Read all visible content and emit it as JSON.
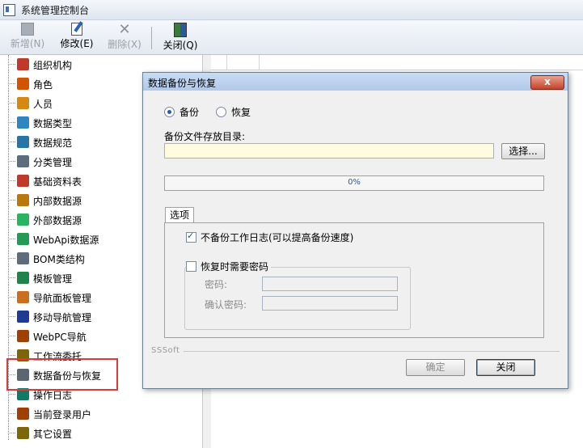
{
  "window": {
    "title": "系统管理控制台"
  },
  "toolbar": {
    "buttons": [
      {
        "label": "新增(N)",
        "icon": "new-icon",
        "enabled": false
      },
      {
        "label": "修改(E)",
        "icon": "edit-icon",
        "enabled": true
      },
      {
        "label": "删除(X)",
        "icon": "delete-icon",
        "enabled": false
      },
      {
        "label": "关闭(Q)",
        "icon": "close-door-icon",
        "enabled": true
      }
    ]
  },
  "tree": {
    "items": [
      {
        "label": "组织机构",
        "icon": "organization-icon",
        "color": "#c0392b"
      },
      {
        "label": "角色",
        "icon": "role-icon",
        "color": "#d35400"
      },
      {
        "label": "人员",
        "icon": "person-icon",
        "color": "#d68910"
      },
      {
        "label": "数据类型",
        "icon": "data-type-icon",
        "color": "#2e86c1"
      },
      {
        "label": "数据规范",
        "icon": "data-spec-icon",
        "color": "#2874a6"
      },
      {
        "label": "分类管理",
        "icon": "category-icon",
        "color": "#5d6d7e"
      },
      {
        "label": "基础资料表",
        "icon": "base-table-icon",
        "color": "#c0392b"
      },
      {
        "label": "内部数据源",
        "icon": "internal-source-icon",
        "color": "#b9770e"
      },
      {
        "label": "外部数据源",
        "icon": "external-source-icon",
        "color": "#28b463"
      },
      {
        "label": "WebApi数据源",
        "icon": "webapi-icon",
        "color": "#239b56"
      },
      {
        "label": "BOM类结构",
        "icon": "bom-icon",
        "color": "#5d6d7e"
      },
      {
        "label": "模板管理",
        "icon": "template-icon",
        "color": "#1e8449"
      },
      {
        "label": "导航面板管理",
        "icon": "nav-panel-icon",
        "color": "#ca6f1e"
      },
      {
        "label": "移动导航管理",
        "icon": "mobile-nav-icon",
        "color": "#1f3a93"
      },
      {
        "label": "WebPC导航",
        "icon": "webpc-icon",
        "color": "#a04000"
      },
      {
        "label": "工作流委托",
        "icon": "workflow-icon",
        "color": "#7d6608"
      },
      {
        "label": "数据备份与恢复",
        "icon": "backup-icon",
        "color": "#5b6770"
      },
      {
        "label": "操作日志",
        "icon": "log-icon",
        "color": "#117a65"
      },
      {
        "label": "当前登录用户",
        "icon": "current-user-icon",
        "color": "#a04000"
      },
      {
        "label": "其它设置",
        "icon": "other-settings-icon",
        "color": "#7d6608"
      }
    ],
    "selected": "数据备份与恢复"
  },
  "dialog": {
    "title": "数据备份与恢复",
    "close_label": "x",
    "modes": [
      {
        "label": "备份",
        "checked": true
      },
      {
        "label": "恢复",
        "checked": false
      }
    ],
    "dir_label": "备份文件存放目录:",
    "dir_value": "",
    "choose_label": "选择...",
    "progress": {
      "text": "0%",
      "value": 0
    },
    "options_tab": "选项",
    "options": {
      "skip_log_label": "不备份工作日志(可以提高备份速度)",
      "skip_log_checked": true,
      "need_password_label": "恢复时需要密码",
      "need_password_checked": false,
      "password_label": "密码:",
      "confirm_password_label": "确认密码:"
    },
    "brand": "SSSoft",
    "ok_label": "确定",
    "close_button_label": "关闭"
  },
  "colors": {
    "highlight": "#e0393b",
    "input_bg": "#fefbdf"
  }
}
